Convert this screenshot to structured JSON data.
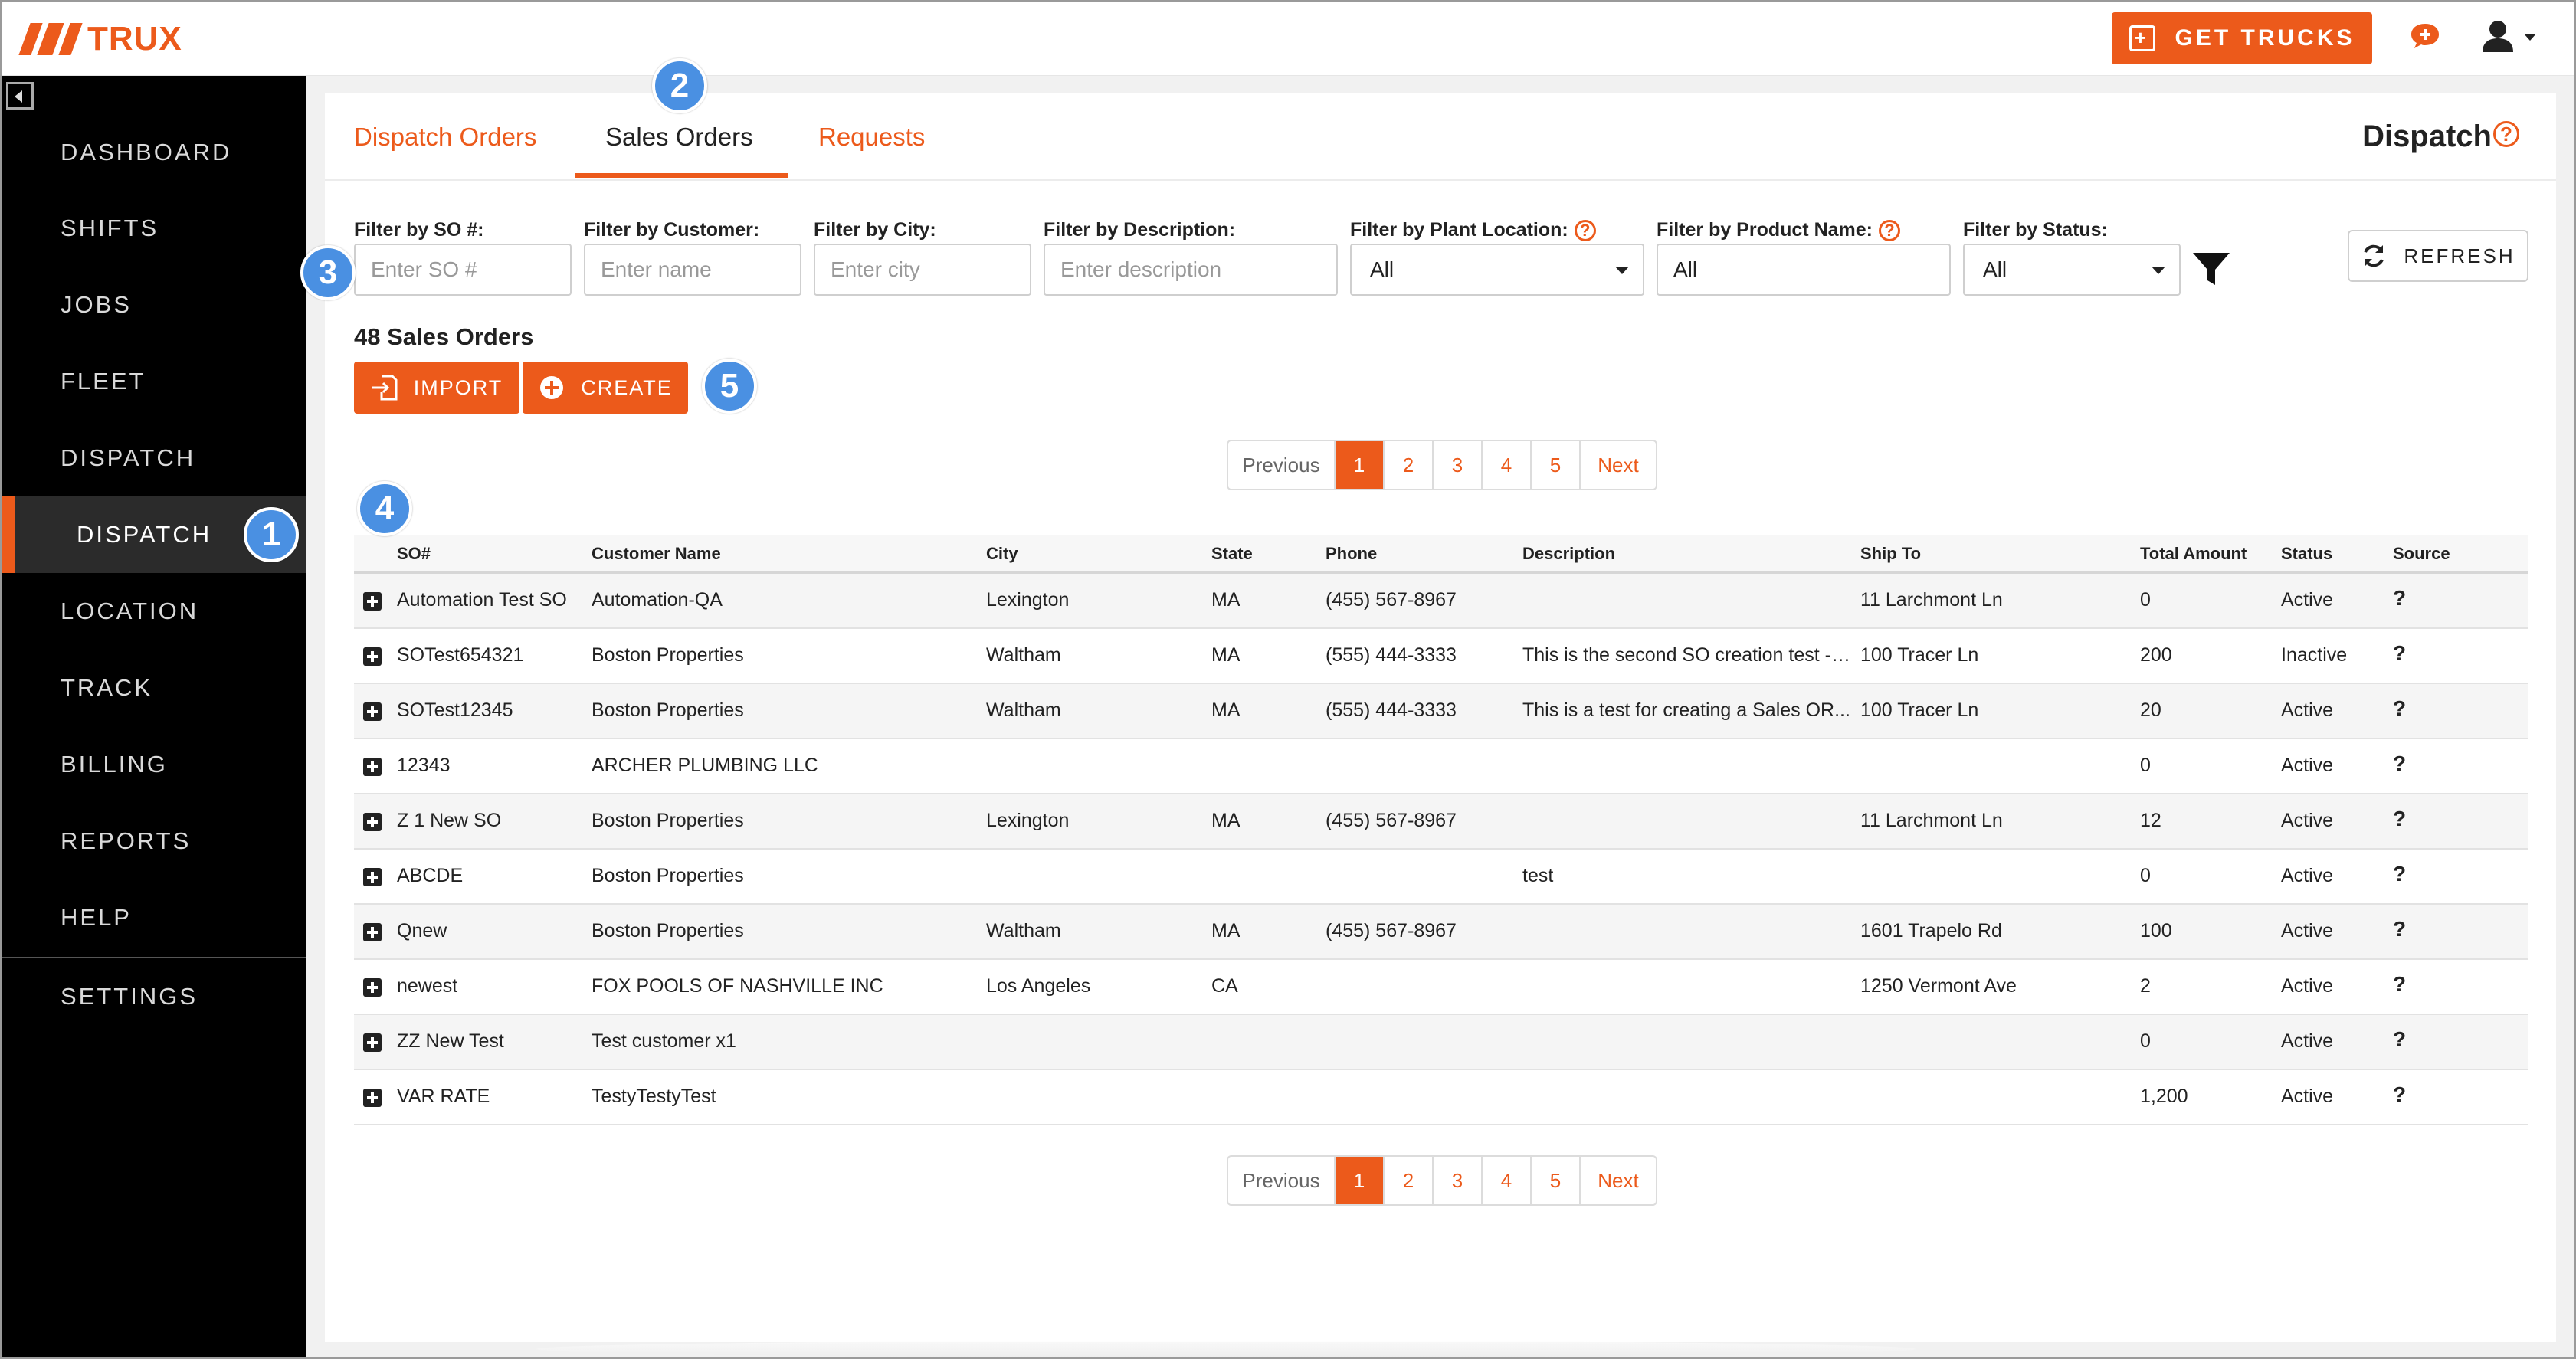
{
  "brand": {
    "name": "TRUX",
    "accent": "#ec5a1b"
  },
  "topbar": {
    "get_trucks_label": "GET TRUCKS",
    "icons": [
      "calendar-plus-icon",
      "chat-icon",
      "user-icon",
      "caret-down-icon"
    ]
  },
  "sidebar": {
    "items": [
      {
        "label": "DASHBOARD"
      },
      {
        "label": "SHIFTS"
      },
      {
        "label": "JOBS"
      },
      {
        "label": "FLEET"
      },
      {
        "label": "DISPATCH"
      },
      {
        "label": "DISPATCH",
        "active": true
      },
      {
        "label": "LOCATION"
      },
      {
        "label": "TRACK"
      },
      {
        "label": "BILLING"
      },
      {
        "label": "REPORTS"
      },
      {
        "label": "HELP"
      },
      {
        "label": "SETTINGS"
      }
    ]
  },
  "tabs": [
    {
      "label": "Dispatch Orders"
    },
    {
      "label": "Sales Orders",
      "active": true
    },
    {
      "label": "Requests"
    }
  ],
  "page_heading": "Dispatch",
  "help_glyph": "?",
  "filters": {
    "so": {
      "label": "Filter by SO #:",
      "placeholder": "Enter SO #"
    },
    "customer": {
      "label": "Filter by Customer:",
      "placeholder": "Enter name"
    },
    "city": {
      "label": "Filter by City:",
      "placeholder": "Enter city"
    },
    "description": {
      "label": "Filter by Description:",
      "placeholder": "Enter description"
    },
    "plant": {
      "label": "Filter by Plant Location:",
      "value": "All"
    },
    "product": {
      "label": "Filter by Product Name:",
      "value": "All"
    },
    "status": {
      "label": "Filter by Status:",
      "value": "All"
    }
  },
  "refresh_label": "REFRESH",
  "count_text": "48 Sales Orders",
  "actions": {
    "import_label": "IMPORT",
    "create_label": "CREATE"
  },
  "pagination": {
    "prev": "Previous",
    "pages": [
      "1",
      "2",
      "3",
      "4",
      "5"
    ],
    "current": "1",
    "next": "Next"
  },
  "table": {
    "headers": [
      "SO#",
      "Customer Name",
      "City",
      "State",
      "Phone",
      "Description",
      "Ship To",
      "Total Amount",
      "Status",
      "Source"
    ],
    "rows": [
      [
        "Automation Test SO",
        "Automation-QA",
        "Lexington",
        "MA",
        "(455) 567-8967",
        "",
        "11 Larchmont Ln",
        "0",
        "Active",
        "?"
      ],
      [
        "SOTest654321",
        "Boston Properties",
        "Waltham",
        "MA",
        "(555) 444-3333",
        "This is the second SO creation test - ...",
        "100 Tracer Ln",
        "200",
        "Inactive",
        "?"
      ],
      [
        "SOTest12345",
        "Boston Properties",
        "Waltham",
        "MA",
        "(555) 444-3333",
        "This is a test for creating a Sales OR...",
        "100 Tracer Ln",
        "20",
        "Active",
        "?"
      ],
      [
        "12343",
        "ARCHER PLUMBING LLC",
        "",
        "",
        "",
        "",
        "",
        "0",
        "Active",
        "?"
      ],
      [
        "Z 1 New SO",
        "Boston Properties",
        "Lexington",
        "MA",
        "(455) 567-8967",
        "",
        "11 Larchmont Ln",
        "12",
        "Active",
        "?"
      ],
      [
        "ABCDE",
        "Boston Properties",
        "",
        "",
        "",
        "test",
        "",
        "0",
        "Active",
        "?"
      ],
      [
        "Qnew",
        "Boston Properties",
        "Waltham",
        "MA",
        "(455) 567-8967",
        "",
        "1601 Trapelo Rd",
        "100",
        "Active",
        "?"
      ],
      [
        "newest",
        "FOX POOLS OF NASHVILLE INC",
        "Los Angeles",
        "CA",
        "",
        "",
        "1250 Vermont Ave",
        "2",
        "Active",
        "?"
      ],
      [
        "ZZ New Test",
        "Test customer x1",
        "",
        "",
        "",
        "",
        "",
        "0",
        "Active",
        "?"
      ],
      [
        "VAR RATE",
        "TestyTestyTest",
        "",
        "",
        "",
        "",
        "",
        "1,200",
        "Active",
        "?"
      ]
    ]
  },
  "callouts": [
    "1",
    "2",
    "3",
    "4",
    "5"
  ],
  "callout_color": "#4a90e2"
}
